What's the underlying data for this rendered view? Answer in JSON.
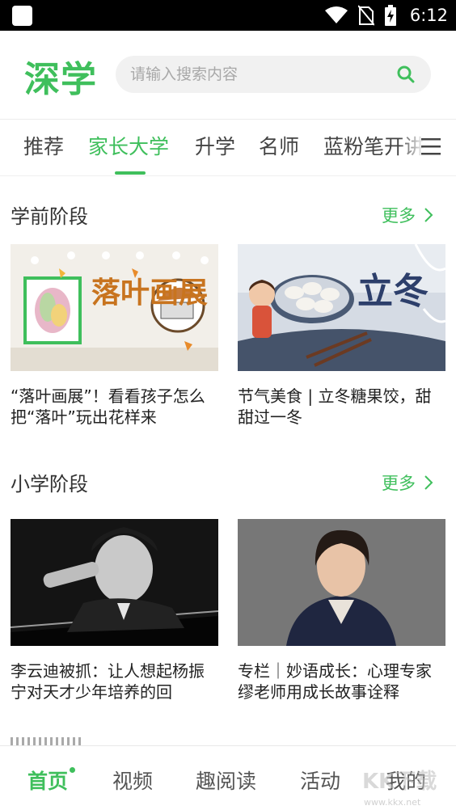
{
  "status_bar": {
    "time": "6:12"
  },
  "header": {
    "logo": "深学",
    "search_placeholder": "请输入搜索内容"
  },
  "tabs": [
    {
      "label": "推荐",
      "active": false
    },
    {
      "label": "家长大学",
      "active": true
    },
    {
      "label": "升学",
      "active": false
    },
    {
      "label": "名师",
      "active": false
    },
    {
      "label": "蓝粉笔开讲",
      "active": false
    }
  ],
  "sections": [
    {
      "title": "学前阶段",
      "more_label": "更多",
      "cards": [
        {
          "title": "“落叶画展”！看看孩子怎么把“落叶”玩出花样来",
          "image_text": "落叶画展"
        },
        {
          "title": "节气美食 | 立冬糖果饺，甜甜过一冬",
          "image_text": "立冬"
        }
      ]
    },
    {
      "title": "小学阶段",
      "more_label": "更多",
      "cards": [
        {
          "title": "李云迪被抓：让人想起杨振宁对天才少年培养的回",
          "image_text": ""
        },
        {
          "title": "专栏｜妙语成长：心理专家缪老师用成长故事诠释",
          "image_text": ""
        }
      ]
    }
  ],
  "bottom_nav": [
    {
      "label": "首页",
      "active": true
    },
    {
      "label": "视频",
      "active": false
    },
    {
      "label": "趣阅读",
      "active": false
    },
    {
      "label": "活动",
      "active": false
    },
    {
      "label": "我的",
      "active": false
    }
  ],
  "watermark": {
    "text": "KK下载",
    "url": "www.kkx.net"
  },
  "colors": {
    "accent": "#3fbf5c",
    "text": "#222222",
    "status_bar": "#000000"
  }
}
